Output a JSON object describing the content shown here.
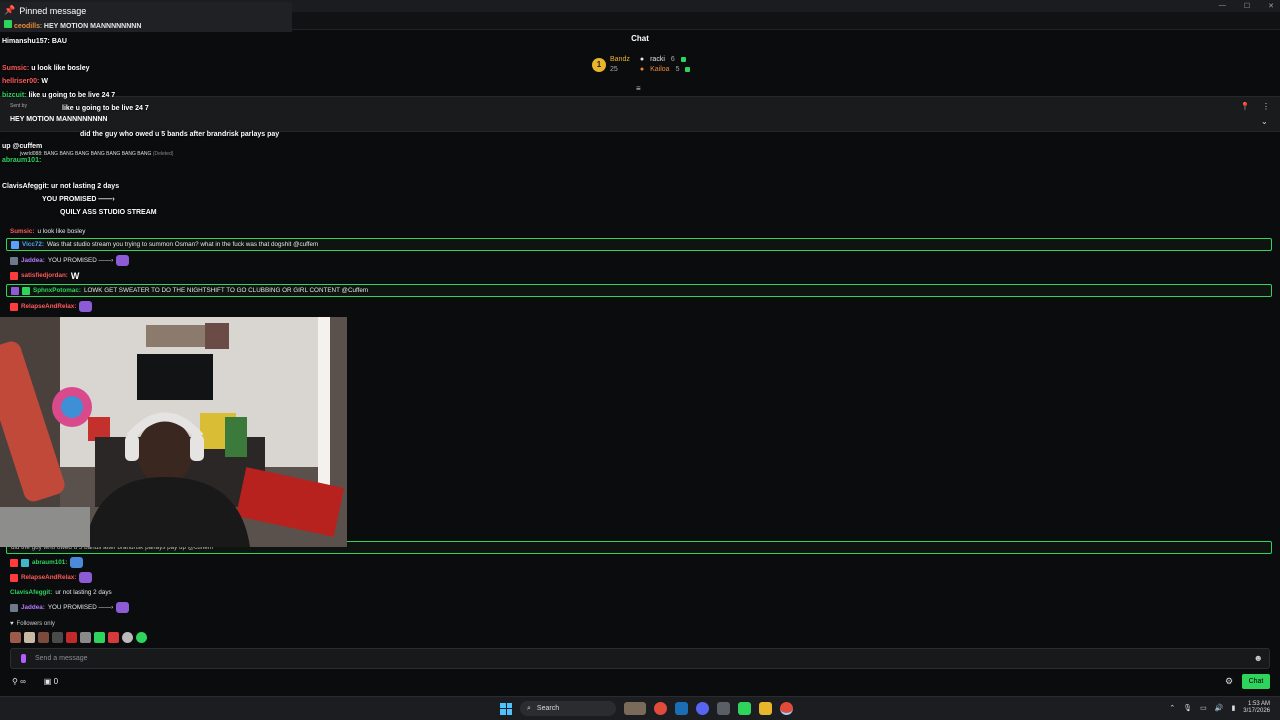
{
  "window": {
    "minimize": "—",
    "maximize": "☐",
    "close": "✕"
  },
  "pinned_header": {
    "title": "Pinned message",
    "user": "ceodills",
    "text": "HEY MOTION MANNNNNNNN"
  },
  "chat_title": "Chat",
  "leaderboard": {
    "rank": "1",
    "left": {
      "name": "Bandz",
      "count": "25"
    },
    "right": [
      {
        "name": "racki",
        "count": "6"
      },
      {
        "name": "Kailoa",
        "count": "5"
      }
    ]
  },
  "pin_bar": {
    "sent_by": "Sent by",
    "text": "HEY MOTION MANNNNNNNN"
  },
  "overlay_messages": [
    {
      "user": "Himanshu157:",
      "text": "BAU",
      "color": "#ffffff"
    },
    {
      "user": "Sumsic:",
      "text": "u look like bosley",
      "color": "#ff5a5a"
    },
    {
      "user": "hellriser00:",
      "text": "W",
      "color": "#ff5a5a"
    },
    {
      "user": "bizcuit:",
      "text": "like u going to be live 24 7",
      "color": "#2fd45d"
    },
    {
      "user": "",
      "text": "did the guy who owed u 5 bands after brandrisk parlays pay",
      "color": "#5aa0ff"
    },
    {
      "user": "",
      "text": "up @cuffem",
      "color": "#ffffff"
    },
    {
      "user": "abraum101:",
      "text": "",
      "color": "#2fd45d"
    },
    {
      "user": "ClavisAfeggit:",
      "text": "ur not lasting 2 days",
      "color": "#ffffff"
    },
    {
      "user": "",
      "text": "YOU PROMISED ——›",
      "color": "#ffffff"
    },
    {
      "user": "",
      "text": "QUILY ASS STUDIO STREAM",
      "color": "#ffffff"
    }
  ],
  "deleted_line": {
    "user": "jvwrld088:",
    "text": "BANG BANG BANG BANG BANG BANG BANG",
    "tag": "(Deleted)"
  },
  "chat": [
    {
      "user": "Sumsic:",
      "text": "u look like bosley",
      "color": "#ff5a5a",
      "hl": false
    },
    {
      "user": "Vicc72:",
      "text": "Was that studio stream you trying to summon Osman? what in the fuck was that dogshit @cuffem",
      "color": "#5aa0ff",
      "hl": true
    },
    {
      "user": "Jaddea:",
      "text": "YOU PROMISED ——›",
      "color": "#b57bff",
      "hl": false
    },
    {
      "user": "satisfiedjordan:",
      "text": "W",
      "color": "#ff5a5a",
      "hl": false
    },
    {
      "user": "SphnxPotomac:",
      "text": "LOWK GET SWEATER TO DO THE NIGHTSHIFT TO GO CLUBBING OR GIRL CONTENT @Cuffem",
      "color": "#2fd45d",
      "hl": true
    },
    {
      "user": "RelapseAndRelax:",
      "text": "",
      "color": "#ff5a5a",
      "hl": false
    }
  ],
  "chat_lower": [
    {
      "user": "",
      "text": "did the guy who owed u 5 bands after brandrisk parlays pay up @cuffem",
      "color": "#5aa0ff",
      "hl": true
    },
    {
      "user": "abraum101:",
      "text": "",
      "color": "#2fd45d",
      "hl": false
    },
    {
      "user": "RelapseAndRelax:",
      "text": "",
      "color": "#ff5a5a",
      "hl": false
    },
    {
      "user": "ClavisAfeggit:",
      "text": "ur not lasting 2 days",
      "color": "#2fd45d",
      "hl": false
    },
    {
      "user": "Jaddea:",
      "text": "YOU PROMISED ——›",
      "color": "#b57bff",
      "hl": false
    }
  ],
  "followers_only": "Followers only",
  "input_placeholder": "Send a message",
  "points": {
    "infinity": "∞",
    "count": "0"
  },
  "chat_button": "Chat",
  "taskbar": {
    "search": "Search",
    "time": "1:53 AM",
    "date": "3/17/2026"
  }
}
